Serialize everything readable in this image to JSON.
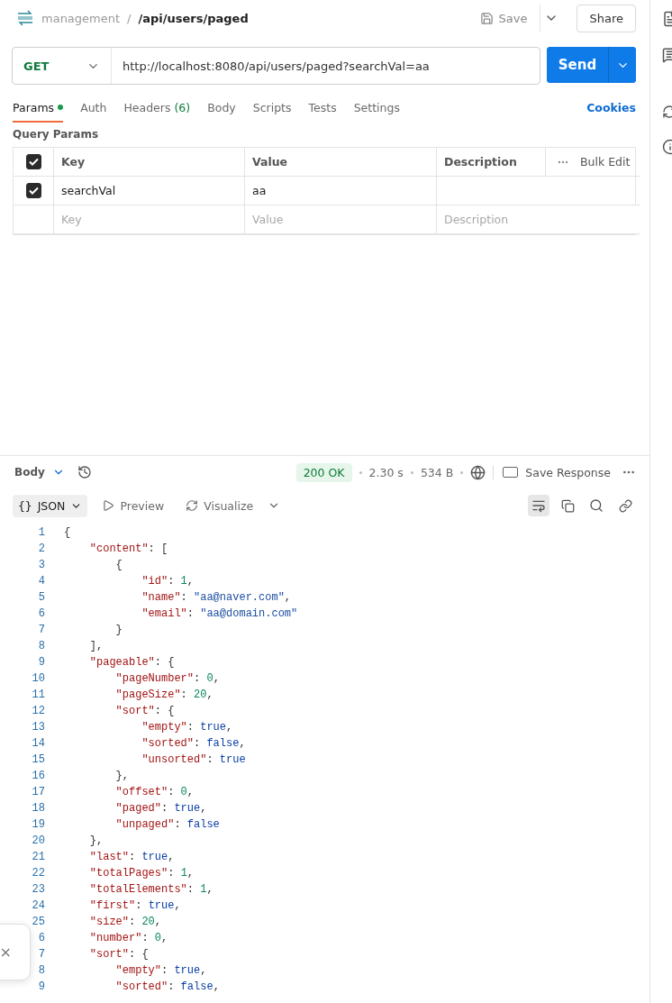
{
  "header": {
    "collection": "management",
    "separator": "/",
    "path": "/api/users/paged",
    "save": "Save",
    "share": "Share"
  },
  "request": {
    "method": "GET",
    "url": "http://localhost:8080/api/users/paged?searchVal=aa",
    "send": "Send"
  },
  "tabs": [
    {
      "label": "Params",
      "selected": true,
      "dot": true
    },
    {
      "label": "Auth",
      "selected": false,
      "dot": false
    },
    {
      "label": "Headers",
      "count": "(6)",
      "selected": false,
      "dot": false
    },
    {
      "label": "Body",
      "selected": false,
      "dot": false
    },
    {
      "label": "Scripts",
      "selected": false,
      "dot": false
    },
    {
      "label": "Tests",
      "selected": false,
      "dot": false
    },
    {
      "label": "Settings",
      "selected": false,
      "dot": false
    }
  ],
  "cookies": "Cookies",
  "params": {
    "title": "Query Params",
    "header": {
      "checked": true,
      "key": "Key",
      "value": "Value",
      "description": "Description",
      "bulk_edit": "Bulk Edit"
    },
    "rows": [
      {
        "checked": true,
        "key": "searchVal",
        "value": "aa"
      }
    ],
    "new_row": [
      {
        "placeholder": "Key"
      },
      {
        "placeholder": "Value"
      },
      {
        "placeholder": "Description"
      }
    ]
  },
  "response": {
    "format_icon": "{}",
    "body_label": "Body",
    "status": "200 OK",
    "time": "2.30 s",
    "size": "534 B",
    "save_response": "Save Response",
    "format": "JSON",
    "preview": "Preview",
    "visualize": "Visualize",
    "lines": [
      {
        "number": "1",
        "tokens": [
          {
            "kind": "p",
            "text": "{"
          }
        ]
      },
      {
        "number": "2",
        "tokens": [
          {
            "kind": "k",
            "text": "\"content\""
          },
          {
            "kind": "p",
            "text": ": ["
          }
        ]
      },
      {
        "number": "3",
        "tokens": [
          {
            "kind": "p",
            "text": "{"
          }
        ]
      },
      {
        "number": "4",
        "tokens": [
          {
            "kind": "k",
            "text": "\"id\""
          },
          {
            "kind": "p",
            "text": ": "
          },
          {
            "kind": "n",
            "text": "1"
          },
          {
            "kind": "p",
            "text": ","
          }
        ]
      },
      {
        "number": "5",
        "tokens": [
          {
            "kind": "k",
            "text": "\"name\""
          },
          {
            "kind": "p",
            "text": ": "
          },
          {
            "kind": "s",
            "text": "\"aa@naver.com\""
          },
          {
            "kind": "p",
            "text": ","
          }
        ]
      },
      {
        "number": "6",
        "tokens": [
          {
            "kind": "k",
            "text": "\"email\""
          },
          {
            "kind": "p",
            "text": ": "
          },
          {
            "kind": "s",
            "text": "\"aa@domain.com\""
          }
        ]
      },
      {
        "number": "7",
        "tokens": [
          {
            "kind": "p",
            "text": "}"
          }
        ]
      },
      {
        "number": "8",
        "tokens": [
          {
            "kind": "p",
            "text": "],"
          }
        ]
      },
      {
        "number": "9",
        "tokens": [
          {
            "kind": "k",
            "text": "\"pageable\""
          },
          {
            "kind": "p",
            "text": ": {"
          }
        ]
      },
      {
        "number": "10",
        "tokens": [
          {
            "kind": "k",
            "text": "\"pageNumber\""
          },
          {
            "kind": "p",
            "text": ": "
          },
          {
            "kind": "n",
            "text": "0"
          },
          {
            "kind": "p",
            "text": ","
          }
        ]
      },
      {
        "number": "11",
        "tokens": [
          {
            "kind": "k",
            "text": "\"pageSize\""
          },
          {
            "kind": "p",
            "text": ": "
          },
          {
            "kind": "n",
            "text": "20"
          },
          {
            "kind": "p",
            "text": ","
          }
        ]
      },
      {
        "number": "12",
        "tokens": [
          {
            "kind": "k",
            "text": "\"sort\""
          },
          {
            "kind": "p",
            "text": ": {"
          }
        ]
      },
      {
        "number": "13",
        "tokens": [
          {
            "kind": "k",
            "text": "\"empty\""
          },
          {
            "kind": "p",
            "text": ": "
          },
          {
            "kind": "b",
            "text": "true"
          },
          {
            "kind": "p",
            "text": ","
          }
        ]
      },
      {
        "number": "14",
        "tokens": [
          {
            "kind": "k",
            "text": "\"sorted\""
          },
          {
            "kind": "p",
            "text": ": "
          },
          {
            "kind": "b",
            "text": "false"
          },
          {
            "kind": "p",
            "text": ","
          }
        ]
      },
      {
        "number": "15",
        "tokens": [
          {
            "kind": "k",
            "text": "\"unsorted\""
          },
          {
            "kind": "p",
            "text": ": "
          },
          {
            "kind": "b",
            "text": "true"
          }
        ]
      },
      {
        "number": "16",
        "tokens": [
          {
            "kind": "p",
            "text": "},"
          }
        ]
      },
      {
        "number": "17",
        "tokens": [
          {
            "kind": "k",
            "text": "\"offset\""
          },
          {
            "kind": "p",
            "text": ": "
          },
          {
            "kind": "n",
            "text": "0"
          },
          {
            "kind": "p",
            "text": ","
          }
        ]
      },
      {
        "number": "18",
        "tokens": [
          {
            "kind": "k",
            "text": "\"paged\""
          },
          {
            "kind": "p",
            "text": ": "
          },
          {
            "kind": "b",
            "text": "true"
          },
          {
            "kind": "p",
            "text": ","
          }
        ]
      },
      {
        "number": "19",
        "tokens": [
          {
            "kind": "k",
            "text": "\"unpaged\""
          },
          {
            "kind": "p",
            "text": ": "
          },
          {
            "kind": "b",
            "text": "false"
          }
        ]
      },
      {
        "number": "20",
        "tokens": [
          {
            "kind": "p",
            "text": "},"
          }
        ]
      },
      {
        "number": "21",
        "tokens": [
          {
            "kind": "k",
            "text": "\"last\""
          },
          {
            "kind": "p",
            "text": ": "
          },
          {
            "kind": "b",
            "text": "true"
          },
          {
            "kind": "p",
            "text": ","
          }
        ]
      },
      {
        "number": "22",
        "tokens": [
          {
            "kind": "k",
            "text": "\"totalPages\""
          },
          {
            "kind": "p",
            "text": ": "
          },
          {
            "kind": "n",
            "text": "1"
          },
          {
            "kind": "p",
            "text": ","
          }
        ]
      },
      {
        "number": "23",
        "tokens": [
          {
            "kind": "k",
            "text": "\"totalElements\""
          },
          {
            "kind": "p",
            "text": ": "
          },
          {
            "kind": "n",
            "text": "1"
          },
          {
            "kind": "p",
            "text": ","
          }
        ]
      },
      {
        "number": "24",
        "tokens": [
          {
            "kind": "k",
            "text": "\"first\""
          },
          {
            "kind": "p",
            "text": ": "
          },
          {
            "kind": "b",
            "text": "true"
          },
          {
            "kind": "p",
            "text": ","
          }
        ]
      },
      {
        "number": "25",
        "tokens": [
          {
            "kind": "k",
            "text": "\"size\""
          },
          {
            "kind": "p",
            "text": ": "
          },
          {
            "kind": "n",
            "text": "20"
          },
          {
            "kind": "p",
            "text": ","
          }
        ]
      },
      {
        "number": "6",
        "tokens": [
          {
            "kind": "k",
            "text": "\"number\""
          },
          {
            "kind": "p",
            "text": ": "
          },
          {
            "kind": "n",
            "text": "0"
          },
          {
            "kind": "p",
            "text": ","
          }
        ]
      },
      {
        "number": "7",
        "tokens": [
          {
            "kind": "k",
            "text": "\"sort\""
          },
          {
            "kind": "p",
            "text": ": {"
          }
        ]
      },
      {
        "number": "8",
        "tokens": [
          {
            "kind": "k",
            "text": "\"empty\""
          },
          {
            "kind": "p",
            "text": ": "
          },
          {
            "kind": "b",
            "text": "true"
          },
          {
            "kind": "p",
            "text": ","
          }
        ]
      },
      {
        "number": "9",
        "tokens": [
          {
            "kind": "k",
            "text": "\"sorted\""
          },
          {
            "kind": "p",
            "text": ": "
          },
          {
            "kind": "b",
            "text": "false"
          },
          {
            "kind": "p",
            "text": ","
          }
        ]
      }
    ]
  },
  "toast": {
    "close": "×"
  }
}
